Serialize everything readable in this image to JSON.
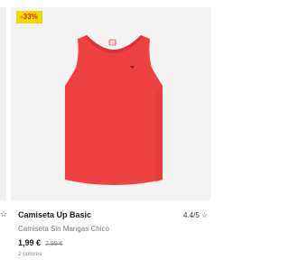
{
  "previous_card": {
    "rating_star": "☆"
  },
  "product": {
    "discount_badge": "-33%",
    "name": "Camiseta Up Basic",
    "rating": "4.4/5 ☆",
    "subtitle": "Camiseta Sin Mangas Chico",
    "price_current": "1,99 €",
    "price_old": "2,99 €",
    "colors_count": "2 colores",
    "image": {
      "description_icon": "tank-top-icon",
      "color": "#ef4141",
      "color_shadow": "#d93535"
    },
    "badge_colors": {
      "background": "#f3d800",
      "text": "#d32f2f"
    }
  }
}
